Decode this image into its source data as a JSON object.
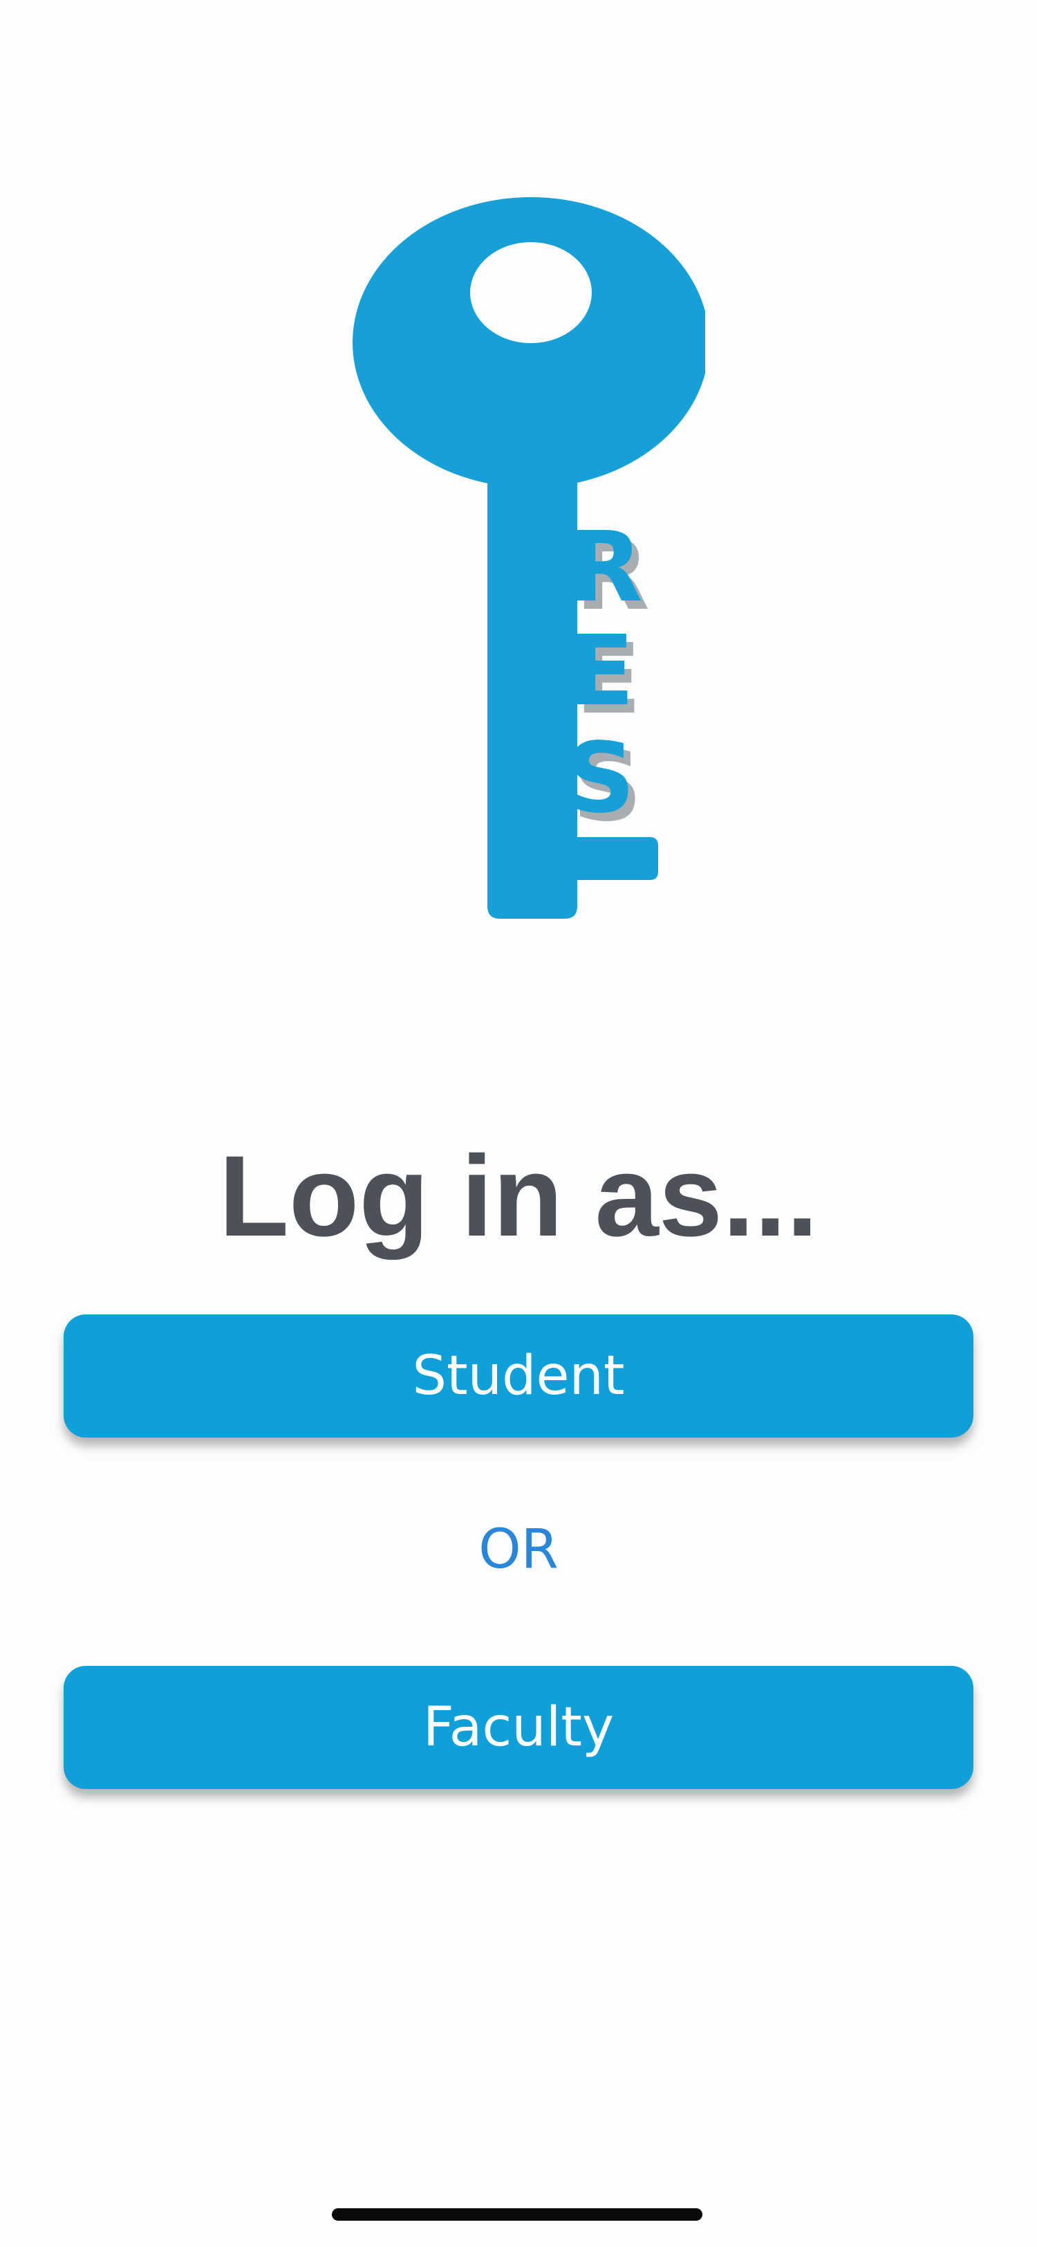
{
  "logo": {
    "name": "REST key logo",
    "letters": [
      "R",
      "E",
      "S"
    ],
    "color": "#179fd8",
    "shadow_color": "#a8adb2"
  },
  "login": {
    "heading": "Log in as...",
    "student_label": "Student",
    "or_label": "OR",
    "faculty_label": "Faculty"
  },
  "colors": {
    "button": "#0f9fd9",
    "heading": "#4d525a",
    "or_text": "#2a86d8",
    "background": "#fdfdfd"
  }
}
